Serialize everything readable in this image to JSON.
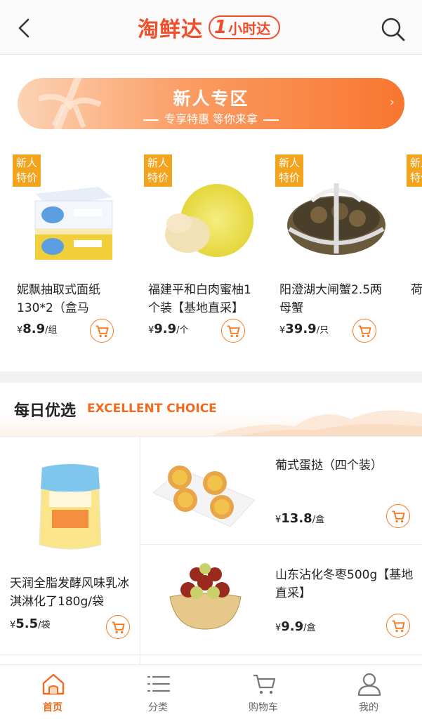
{
  "header": {
    "logo_main": "淘鲜达",
    "logo_badge_num": "1",
    "logo_badge_text": "小时达"
  },
  "banner": {
    "title": "新人专区",
    "subtitle": "专享特惠 等你来拿"
  },
  "newcomer": {
    "badge_line1": "新人",
    "badge_line2": "特价",
    "items": [
      {
        "name": "妮飘抽取式面纸130*2（盒马",
        "currency": "¥",
        "price": "8.9",
        "unit": "/组"
      },
      {
        "name": "福建平和白肉蜜柚1个装【基地直采】",
        "currency": "¥",
        "price": "9.9",
        "unit": "/个"
      },
      {
        "name": "阳澄湖大闸蟹2.5两母蟹",
        "currency": "¥",
        "price": "39.9",
        "unit": "/只"
      },
      {
        "name": "荷"
      }
    ]
  },
  "daily": {
    "title": "每日优选",
    "subtitle": "EXCELLENT CHOICE",
    "items": [
      {
        "name": "天润全脂发酵风味乳冰淇淋化了180g/袋",
        "currency": "¥",
        "price": "5.5",
        "unit": "/袋"
      },
      {
        "name": "葡式蛋挞（四个装）",
        "currency": "¥",
        "price": "13.8",
        "unit": "/盒"
      },
      {
        "name": "山东沾化冬枣500g【基地直采】",
        "currency": "¥",
        "price": "9.9",
        "unit": "/盒"
      }
    ]
  },
  "nav": {
    "items": [
      {
        "label": "首页",
        "icon": "home-icon",
        "active": true
      },
      {
        "label": "分类",
        "icon": "category-icon",
        "active": false
      },
      {
        "label": "购物车",
        "icon": "cart-icon",
        "active": false
      },
      {
        "label": "我的",
        "icon": "user-icon",
        "active": false
      }
    ]
  },
  "colors": {
    "accent": "#f26a1e",
    "badge": "#f4a31c",
    "logo": "#f04e2a"
  }
}
